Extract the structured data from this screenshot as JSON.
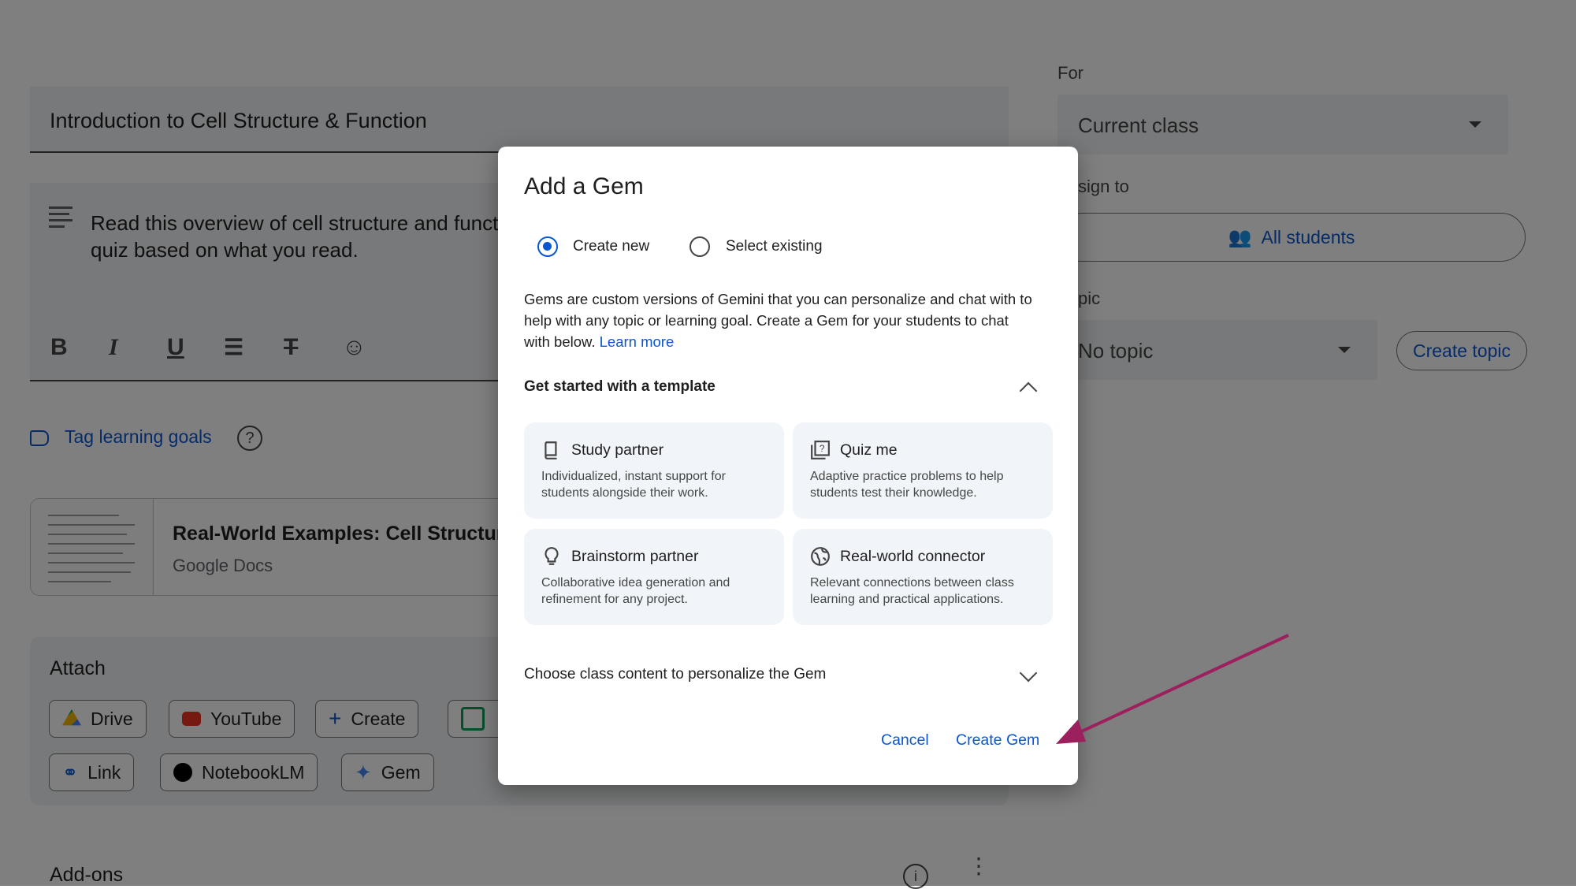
{
  "background": {
    "title_value": "Introduction to Cell Structure & Function",
    "description_value": "Read this overview of cell structure and functi quiz based on what you read.",
    "tag_learning_goals": "Tag learning goals",
    "attachment": {
      "title": "Real-World Examples: Cell Structure",
      "type": "Google Docs"
    },
    "attach_heading": "Attach",
    "attach_chips": [
      "Drive",
      "YouTube",
      "Create",
      "Link",
      "NotebookLM",
      "Gem"
    ],
    "addons_heading": "Add-ons",
    "for_label": "For",
    "for_value": "Current class",
    "assign_label": "sign to",
    "assign_value": "All students",
    "topic_label": "pic",
    "topic_value": "No topic",
    "create_topic": "Create topic"
  },
  "dialog": {
    "title": "Add a Gem",
    "radio_options": [
      {
        "label": "Create new",
        "selected": true
      },
      {
        "label": "Select existing",
        "selected": false
      }
    ],
    "intro_text": "Gems are custom versions of Gemini that you can personalize and chat with to help with any topic or learning goal. Create a Gem for your students to chat with below.",
    "learn_more": "Learn more",
    "template_section": "Get started with a template",
    "templates": [
      {
        "title": "Study partner",
        "desc": "Individualized, instant support for students alongside their work.",
        "icon": "book-icon"
      },
      {
        "title": "Quiz me",
        "desc": "Adaptive practice problems to help students test their knowledge.",
        "icon": "quiz-icon"
      },
      {
        "title": "Brainstorm partner",
        "desc": "Collaborative idea generation and refinement for any project.",
        "icon": "lightbulb-icon"
      },
      {
        "title": "Real-world connector",
        "desc": "Relevant connections between class learning and practical applications.",
        "icon": "globe-icon"
      }
    ],
    "class_content_section": "Choose class content to personalize the Gem",
    "cancel": "Cancel",
    "create_gem": "Create Gem"
  },
  "colors": {
    "accent": "#0b57d0",
    "arrow": "#9c1f5e",
    "card_bg": "#f1f4f8"
  }
}
